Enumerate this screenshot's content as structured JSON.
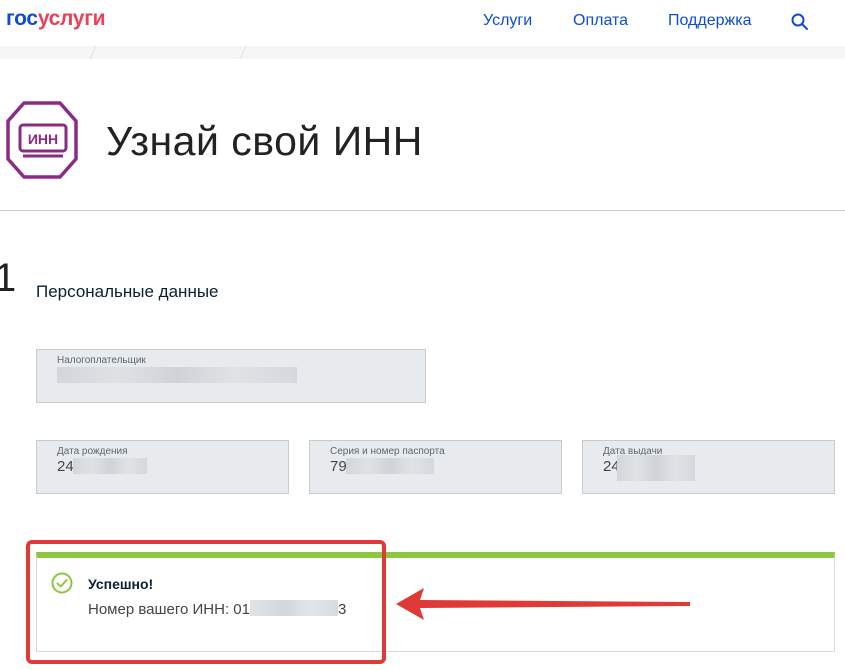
{
  "header": {
    "logo_part1": "гос",
    "logo_part2": "услуги",
    "nav": [
      "Услуги",
      "Оплата",
      "Поддержка"
    ],
    "search_icon": "search-icon"
  },
  "page": {
    "icon_text": "ИНН",
    "title": "Узнай свой ИНН"
  },
  "section": {
    "step": "1",
    "title": "Персональные данные"
  },
  "fields": {
    "taxpayer": {
      "label": "Налогоплательщик",
      "value": ""
    },
    "birth_date": {
      "label": "Дата рождения",
      "value": "24"
    },
    "passport": {
      "label": "Серия и номер паспорта",
      "value": "79"
    },
    "issue_date": {
      "label": "Дата выдачи",
      "value": "24"
    }
  },
  "result": {
    "status": "Успешно!",
    "inn_label": "Номер вашего ИНН: ",
    "inn_start": "01",
    "inn_end": "3"
  },
  "colors": {
    "brand_blue": "#0d4cd3",
    "brand_red": "#ee3f58",
    "icon_purple": "#8b2b85",
    "success_green": "#8dc63f",
    "annotation_red": "#e03a36"
  }
}
